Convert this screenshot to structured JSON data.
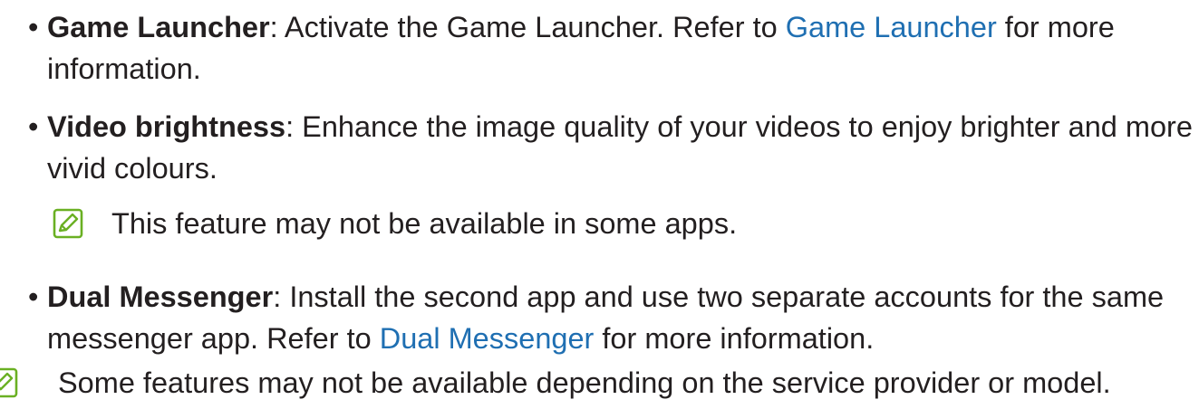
{
  "items": [
    {
      "bullet": "•",
      "term": "Game Launcher",
      "text_before": ": Activate the Game Launcher. Refer to ",
      "link": "Game Launcher",
      "text_after": " for more information."
    },
    {
      "bullet": "•",
      "term": "Video brightness",
      "text": ": Enhance the image quality of your videos to enjoy brighter and more vivid colours."
    },
    {
      "bullet": "•",
      "term": "Dual Messenger",
      "text_before": ": Install the second app and use two separate accounts for the same messenger app. Refer to ",
      "link": "Dual Messenger",
      "text_after": " for more information."
    }
  ],
  "notes": [
    {
      "icon": "note-icon",
      "text": "This feature may not be available in some apps."
    },
    {
      "icon": "note-icon",
      "text": "Some features may not be available depending on the service provider or model."
    }
  ],
  "colors": {
    "text": "#231f20",
    "link": "#1f6fb2",
    "icon": "#6ab023"
  }
}
